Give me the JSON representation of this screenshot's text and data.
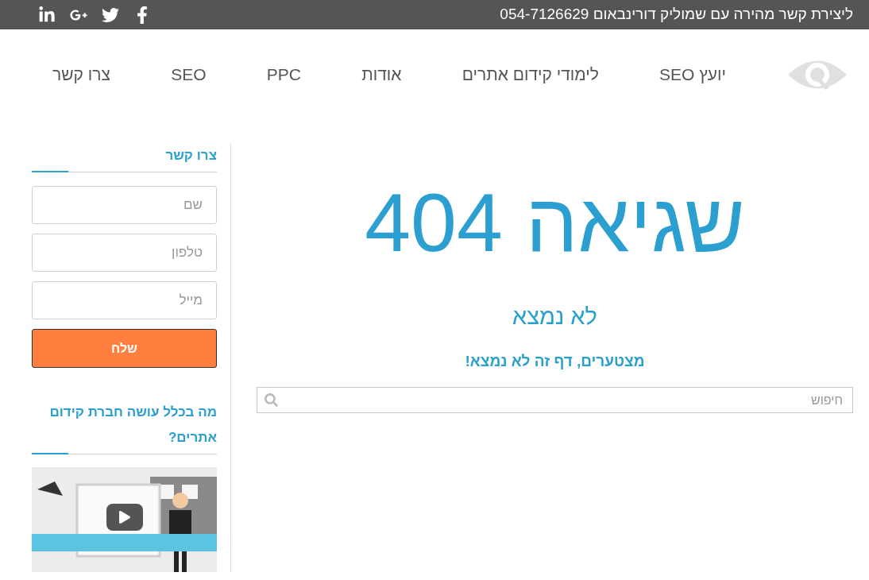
{
  "top_bar": {
    "contact_text": "ליצירת קשר מהירה עם שמוליק דורינבאום 054-7126629",
    "social": [
      {
        "kind": "facebook"
      },
      {
        "kind": "twitter"
      },
      {
        "kind": "googleplus"
      },
      {
        "kind": "linkedin"
      }
    ]
  },
  "nav": {
    "items": [
      "יועץ SEO",
      "לימודי קידום אתרים",
      "אודות",
      "PPC",
      "SEO",
      "צרו קשר"
    ]
  },
  "main": {
    "title": "שגיאה 404",
    "subtitle": "לא נמצא",
    "message": "מצטערים, דף זה לא נמצא!",
    "search": {
      "placeholder": "חיפוש"
    }
  },
  "sidebar": {
    "contact_form": {
      "title": "צרו קשר",
      "fields": [
        {
          "placeholder": "שם"
        },
        {
          "placeholder": "טלפון"
        },
        {
          "placeholder": "מייל"
        }
      ],
      "submit": "שלח"
    },
    "video_widget": {
      "title": "מה בכלל עושה חברת קידום אתרים?"
    }
  }
}
